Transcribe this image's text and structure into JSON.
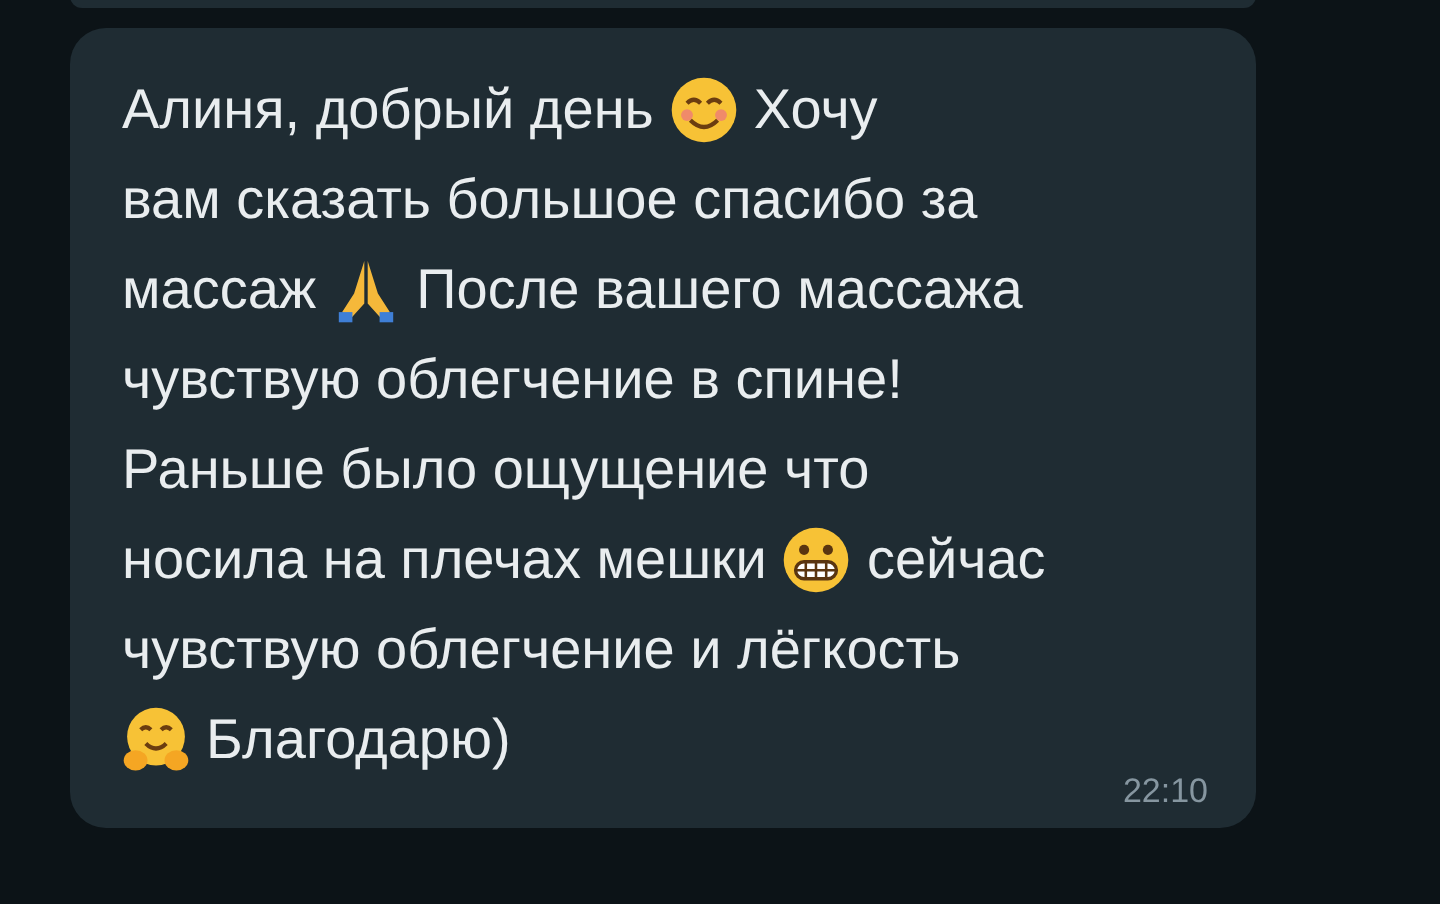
{
  "message": {
    "lines": [
      [
        {
          "kind": "text",
          "text": "Алиня, добрый день"
        },
        {
          "kind": "smile"
        },
        {
          "kind": "text",
          "text": "Хочу"
        }
      ],
      [
        {
          "kind": "text",
          "text": "вам сказать большое спасибо за"
        }
      ],
      [
        {
          "kind": "text",
          "text": "массаж"
        },
        {
          "kind": "pray"
        },
        {
          "kind": "text",
          "text": "После вашего массажа"
        }
      ],
      [
        {
          "kind": "text",
          "text": "чувствую облегчение в спине!"
        }
      ],
      [
        {
          "kind": "text",
          "text": "Раньше было ощущение что"
        }
      ],
      [
        {
          "kind": "text",
          "text": "носила на плечах мешки"
        },
        {
          "kind": "grimace"
        },
        {
          "kind": "text",
          "text": "сейчас"
        }
      ],
      [
        {
          "kind": "text",
          "text": "чувствую облегчение и лёгкость"
        }
      ],
      [
        {
          "kind": "hug"
        },
        {
          "kind": "text",
          "text": "Благодарю)"
        }
      ]
    ],
    "time": "22:10"
  }
}
